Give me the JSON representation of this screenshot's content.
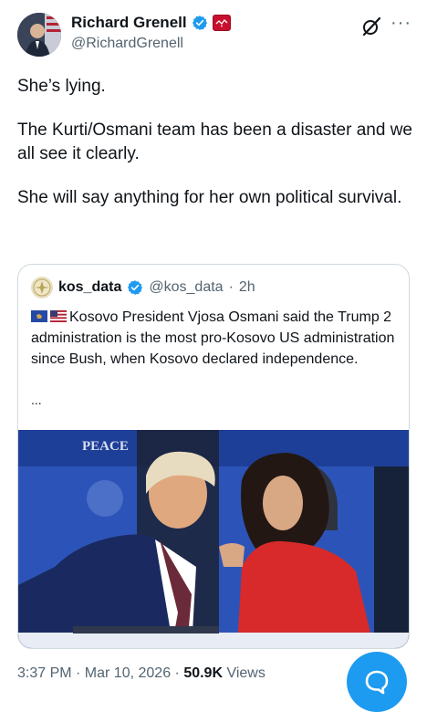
{
  "author": {
    "name": "Richard Grenell",
    "handle": "@RichardGrenell",
    "verified_color": "#1d9bf0",
    "affiliation_badge_text": "Affiliation"
  },
  "header": {
    "more_icon": "more-icon",
    "grok_icon": "grok-icon"
  },
  "tweet": {
    "paragraphs": [
      "She’s lying.",
      "The Kurti/Osmani team has been a disaster and we all see it clearly.",
      "She will say anything for her own political survival."
    ]
  },
  "quote": {
    "name": "kos_data",
    "handle": "@kos_data",
    "separator": "·",
    "time": "2h",
    "text": "Kosovo President Vjosa Osmani said the Trump 2 administration is the most pro-Kosovo US administration since Bush, when Kosovo declared independence.",
    "more": "...",
    "media_banner_text": "PEACE"
  },
  "meta": {
    "time": "3:37 PM · Mar 10, 2026 · ",
    "views_count": "50.9K",
    "views_label": " Views"
  },
  "fab_icon": "reply-bubble-icon",
  "colors": {
    "accent": "#1d9bf0",
    "secondary_text": "#536471"
  }
}
